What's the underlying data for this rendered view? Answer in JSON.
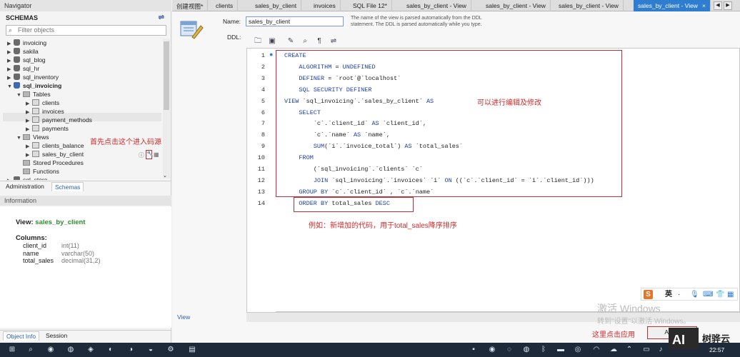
{
  "navigator": {
    "title": "Navigator",
    "schemas_label": "SCHEMAS",
    "filter_placeholder": "Filter objects",
    "tree": [
      {
        "label": "invoicing",
        "level": 0,
        "kind": "db"
      },
      {
        "label": "sakila",
        "level": 0,
        "kind": "db"
      },
      {
        "label": "sql_blog",
        "level": 0,
        "kind": "db"
      },
      {
        "label": "sql_hr",
        "level": 0,
        "kind": "db"
      },
      {
        "label": "sql_inventory",
        "level": 0,
        "kind": "db"
      },
      {
        "label": "sql_invoicing",
        "level": 0,
        "kind": "db-open"
      },
      {
        "label": "Tables",
        "level": 1,
        "kind": "folder"
      },
      {
        "label": "clients",
        "level": 2,
        "kind": "table"
      },
      {
        "label": "invoices",
        "level": 2,
        "kind": "table"
      },
      {
        "label": "payment_methods",
        "level": 2,
        "kind": "table"
      },
      {
        "label": "payments",
        "level": 2,
        "kind": "table"
      },
      {
        "label": "Views",
        "level": 1,
        "kind": "folder"
      },
      {
        "label": "clients_balance",
        "level": 2,
        "kind": "table"
      },
      {
        "label": "sales_by_client",
        "level": 2,
        "kind": "table"
      },
      {
        "label": "Stored Procedures",
        "level": 1,
        "kind": "folder-leaf"
      },
      {
        "label": "Functions",
        "level": 1,
        "kind": "folder-leaf"
      },
      {
        "label": "sql_store",
        "level": 0,
        "kind": "db"
      }
    ],
    "tabs": [
      "Administration",
      "Schemas"
    ],
    "active_tab": "Schemas"
  },
  "information": {
    "title": "Information",
    "view_label": "View:",
    "view_name": "sales_by_client",
    "columns_label": "Columns:",
    "columns": [
      {
        "name": "client_id",
        "type": "int(11)"
      },
      {
        "name": "name",
        "type": "varchar(50)"
      },
      {
        "name": "total_sales",
        "type": "decimal(31,2)"
      }
    ],
    "bottom_tabs": [
      "Object Info",
      "Session"
    ]
  },
  "tabs": [
    {
      "label": "创建视图*"
    },
    {
      "label": "clients"
    },
    {
      "label": "sales_by_client"
    },
    {
      "label": "invoices"
    },
    {
      "label": "SQL File 12*"
    },
    {
      "label": "sales_by_client - View"
    },
    {
      "label": "sales_by_client - View"
    },
    {
      "label": "sales_by_client - View"
    },
    {
      "label": "sales_by_client - View",
      "active": true
    }
  ],
  "editor": {
    "name_label": "Name:",
    "name_value": "sales_by_client",
    "name_hint": "The name of the view is parsed automatically from the DDL statement. The DDL is parsed automatically while you type.",
    "ddl_label": "DDL:",
    "lines": [
      "CREATE",
      "    ALGORITHM = UNDEFINED",
      "    DEFINER = `root`@`localhost`",
      "    SQL SECURITY DEFINER",
      "VIEW `sql_invoicing`.`sales_by_client` AS",
      "    SELECT",
      "        `c`.`client_id` AS `client_id`,",
      "        `c`.`name` AS `name`,",
      "        SUM(`i`.`invoice_total`) AS `total_sales`",
      "    FROM",
      "        (`sql_invoicing`.`clients` `c`",
      "        JOIN `sql_invoicing`.`invoices` `i` ON ((`c`.`client_id` = `i`.`client_id`)))",
      "    GROUP BY `c`.`client_id` , `c`.`name`",
      "    ORDER BY total_sales DESC"
    ],
    "view_tab": "View",
    "apply_button": "Apply"
  },
  "annotations": {
    "editable_note": "可以进行编辑及修改",
    "click_source_note": "首先点击这个进入码源",
    "new_code_note": "例如：新增加的代码，用于total_sales降序排序",
    "apply_note": "这里点击应用"
  },
  "watermark": {
    "line1": "激活 Windows",
    "line2": "转到\"设置\"以激活 Windows。"
  },
  "ime": {
    "label": "英"
  },
  "taskbar": {
    "time": "22:57"
  },
  "logo": {
    "text": "树骅云"
  },
  "colors": {
    "accent": "#2f7dd1",
    "annotation": "#d02a2a",
    "keyword": "#1d3fa8"
  }
}
